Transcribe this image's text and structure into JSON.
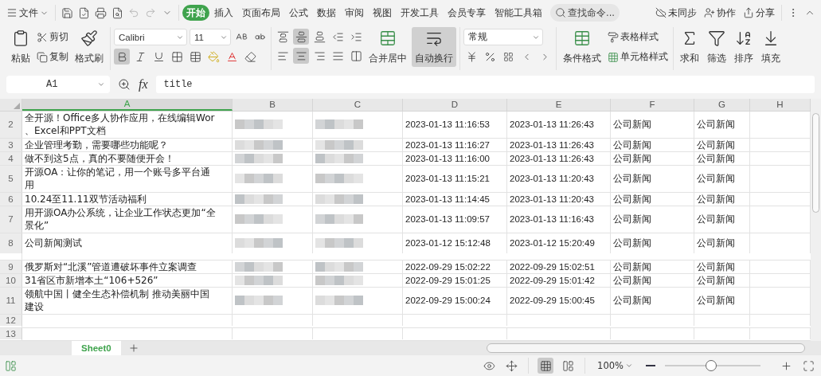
{
  "menu": {
    "file": "文件"
  },
  "tabs": [
    {
      "label": "开始",
      "selected": true
    },
    {
      "label": "插入",
      "selected": false
    },
    {
      "label": "页面布局",
      "selected": false
    },
    {
      "label": "公式",
      "selected": false
    },
    {
      "label": "数据",
      "selected": false
    },
    {
      "label": "审阅",
      "selected": false
    },
    {
      "label": "视图",
      "selected": false
    },
    {
      "label": "开发工具",
      "selected": false
    },
    {
      "label": "会员专享",
      "selected": false
    },
    {
      "label": "智能工具箱",
      "selected": false
    }
  ],
  "search": {
    "placeholder": "查找命令..."
  },
  "top_actions": [
    {
      "kind": "sync",
      "label": "未同步"
    },
    {
      "kind": "collab",
      "label": "协作"
    },
    {
      "kind": "share",
      "label": "分享"
    }
  ],
  "ribbon": {
    "paste": "粘贴",
    "cut": "剪切",
    "copy": "复制",
    "format_painter": "格式刷",
    "font_name": "Calibri",
    "font_size": "11",
    "bold": true,
    "italic": false,
    "underline": false,
    "vertical_align": [
      {
        "selected": false
      },
      {
        "selected": true
      },
      {
        "selected": false
      }
    ],
    "horizontal_align": [
      {
        "selected": false
      },
      {
        "selected": true
      },
      {
        "selected": false
      },
      {
        "selected": false
      }
    ],
    "merge": "合并居中",
    "wrap": {
      "label": "自动换行",
      "on": true
    },
    "number_format": "常规",
    "conditional": "条件格式",
    "table_style": "表格样式",
    "cell_style": "单元格样式",
    "sum": "求和",
    "filter": "筛选",
    "sort": "排序",
    "fill": "填充"
  },
  "formula_bar": {
    "cell": "A1",
    "fx": "fx",
    "value": "title"
  },
  "columns": [
    {
      "label": "A",
      "selected": true
    },
    {
      "label": "B",
      "selected": false
    },
    {
      "label": "C",
      "selected": false
    },
    {
      "label": "D",
      "selected": false
    },
    {
      "label": "E",
      "selected": false
    },
    {
      "label": "F",
      "selected": false
    },
    {
      "label": "G",
      "selected": false
    },
    {
      "label": "H",
      "selected": false
    }
  ],
  "rows": [
    {
      "number": "2",
      "tall": true,
      "blurred": true,
      "a": [
        "全开源！Office多人协作应用，在线编辑Wor",
        "、Excel和PPT文档"
      ],
      "d": "2023-01-13 11:16:53",
      "e": "2023-01-13 11:26:43",
      "f": "公司新闻",
      "g": "公司新闻"
    },
    {
      "number": "3",
      "tall": false,
      "blurred": true,
      "a": [
        "企业管理考勤，需要哪些功能呢？"
      ],
      "d": "2023-01-13 11:16:27",
      "e": "2023-01-13 11:26:43",
      "f": "公司新闻",
      "g": "公司新闻"
    },
    {
      "number": "4",
      "tall": false,
      "blurred": true,
      "a": [
        "做不到这5点，真的不要随便开会！"
      ],
      "d": "2023-01-13 11:16:00",
      "e": "2023-01-13 11:26:43",
      "f": "公司新闻",
      "g": "公司新闻"
    },
    {
      "number": "5",
      "tall": true,
      "blurred": true,
      "a": [
        "开源OA：让你的笔记，用一个账号多平台通",
        "用"
      ],
      "d": "2023-01-13 11:15:21",
      "e": "2023-01-13 11:20:43",
      "f": "公司新闻",
      "g": "公司新闻"
    },
    {
      "number": "6",
      "tall": false,
      "blurred": true,
      "a": [
        "10.24至11.11双节活动福利"
      ],
      "d": "2023-01-13 11:14:45",
      "e": "2023-01-13 11:20:43",
      "f": "公司新闻",
      "g": "公司新闻"
    },
    {
      "number": "7",
      "tall": true,
      "blurred": true,
      "a": [
        "用开源OA办公系统，让企业工作状态更加“全",
        "景化”"
      ],
      "d": "2023-01-13 11:09:57",
      "e": "2023-01-13 11:16:43",
      "f": "公司新闻",
      "g": "公司新闻"
    },
    {
      "number": "8",
      "tall": true,
      "blurred": true,
      "a": [
        "公司新闻测试"
      ],
      "d": "2023-01-12 15:12:48",
      "e": "2023-01-12 15:20:49",
      "f": "公司新闻",
      "g": "公司新闻"
    },
    {
      "number": "9",
      "tall": false,
      "blurred": true,
      "a": [
        "俄罗斯对“北溪”管道遭破坏事件立案调查"
      ],
      "d": "2022-09-29 15:02:22",
      "e": "2022-09-29 15:02:51",
      "f": "公司新闻",
      "g": "公司新闻"
    },
    {
      "number": "10",
      "tall": false,
      "blurred": true,
      "a": [
        "31省区市新增本土“106+526”"
      ],
      "d": "2022-09-29 15:01:25",
      "e": "2022-09-29 15:01:42",
      "f": "公司新闻",
      "g": "公司新闻"
    },
    {
      "number": "11",
      "tall": true,
      "blurred": true,
      "a": [
        "领航中国丨健全生态补偿机制 推动美丽中国",
        "建设"
      ],
      "d": "2022-09-29 15:00:24",
      "e": "2022-09-29 15:00:45",
      "f": "公司新闻",
      "g": "公司新闻"
    },
    {
      "number": "12",
      "tall": false,
      "blurred": false
    },
    {
      "number": "13",
      "tall": false,
      "blurred": false
    }
  ],
  "sheets": [
    {
      "label": "Sheet0",
      "selected": true
    }
  ],
  "status_bar": {
    "views": [
      {
        "kind": "normal",
        "selected": true
      },
      {
        "kind": "page",
        "selected": false
      }
    ],
    "zoom": "100%",
    "zoom_slider": {
      "level": 0.48
    }
  }
}
